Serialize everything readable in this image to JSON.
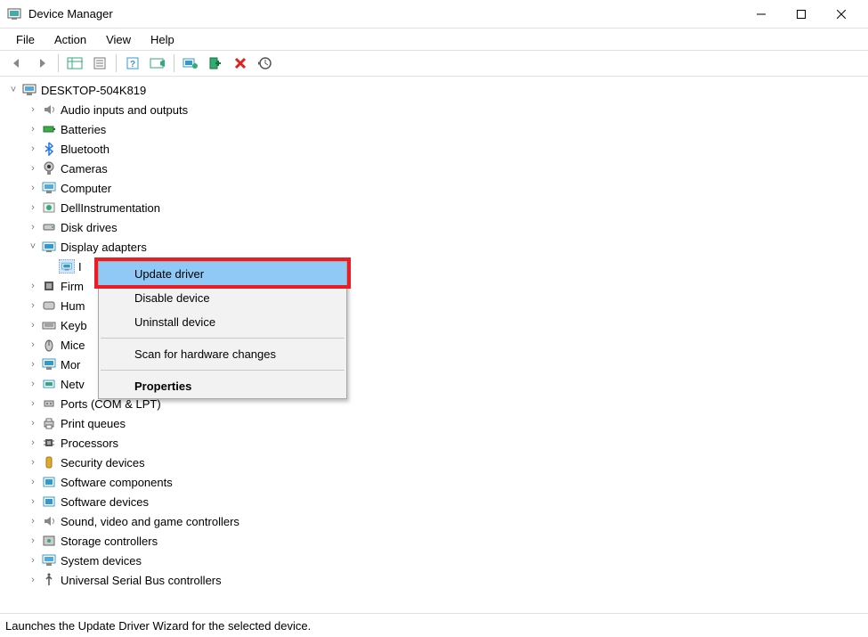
{
  "window": {
    "title": "Device Manager"
  },
  "menu": {
    "file": "File",
    "action": "Action",
    "view": "View",
    "help": "Help"
  },
  "tree": {
    "root": "DESKTOP-504K819",
    "items": [
      "Audio inputs and outputs",
      "Batteries",
      "Bluetooth",
      "Cameras",
      "Computer",
      "DellInstrumentation",
      "Disk drives",
      "Display adapters",
      "Firmware",
      "Human Interface Devices",
      "Keyboards",
      "Mice and other pointing devices",
      "Monitors",
      "Network adapters",
      "Ports (COM & LPT)",
      "Print queues",
      "Processors",
      "Security devices",
      "Software components",
      "Software devices",
      "Sound, video and game controllers",
      "Storage controllers",
      "System devices",
      "Universal Serial Bus controllers"
    ],
    "display_child_stub": "I",
    "trunc": {
      "firmware": "Firm",
      "hid": "Hum",
      "keyboards": "Keyb",
      "mice": "Mice",
      "monitors": "Mor",
      "network": "Netv"
    }
  },
  "context_menu": {
    "update_driver": "Update driver",
    "disable_device": "Disable device",
    "uninstall_device": "Uninstall device",
    "scan": "Scan for hardware changes",
    "properties": "Properties"
  },
  "status": "Launches the Update Driver Wizard for the selected device."
}
